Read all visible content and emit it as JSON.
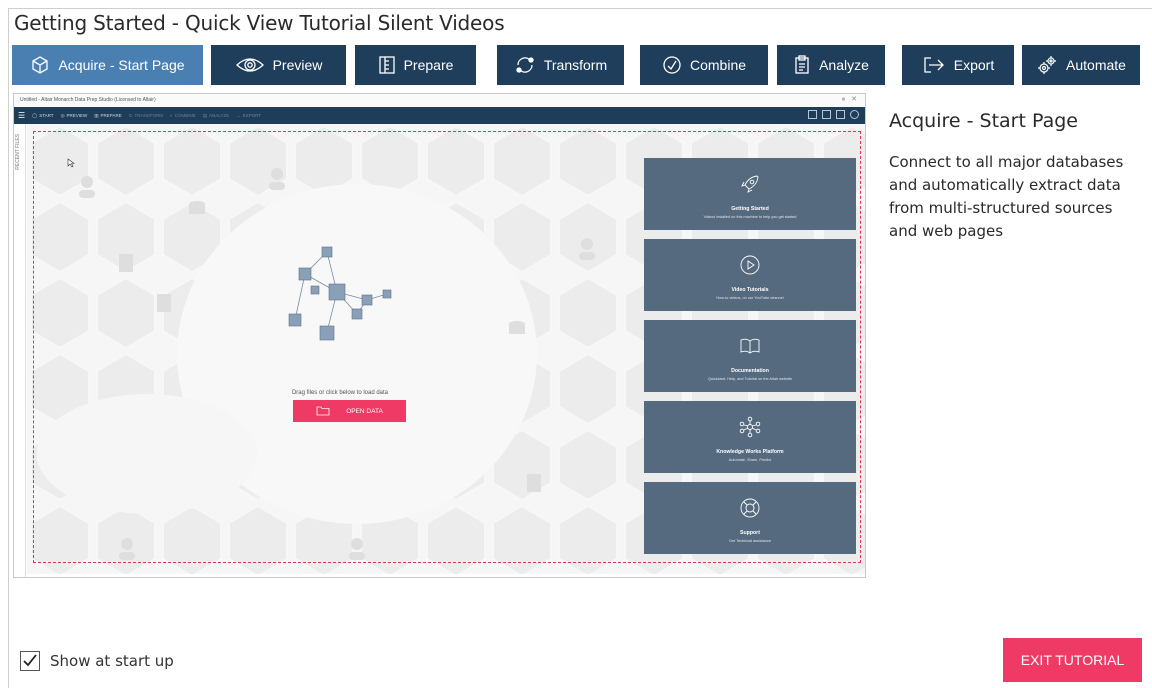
{
  "window": {
    "title": "Getting Started - Quick View Tutorial Silent Videos"
  },
  "tabs": [
    {
      "label": "Acquire - Start Page",
      "icon": "cube-icon",
      "active": true
    },
    {
      "label": "Preview",
      "icon": "eye-icon",
      "active": false
    },
    {
      "label": "Prepare",
      "icon": "columns-icon",
      "active": false
    },
    {
      "label": "Transform",
      "icon": "transform-cycle-icon",
      "active": false
    },
    {
      "label": "Combine",
      "icon": "combine-icon",
      "active": false
    },
    {
      "label": "Analyze",
      "icon": "clipboard-icon",
      "active": false
    },
    {
      "label": "Export",
      "icon": "export-arrow-icon",
      "active": false
    },
    {
      "label": "Automate",
      "icon": "gears-icon",
      "active": false
    }
  ],
  "screenshot": {
    "window_title": "Untitled - Altair Monarch Data Prep Studio (Licensed to Altair)",
    "toolbar_items": [
      {
        "label": "START",
        "dim": false
      },
      {
        "label": "PREVIEW",
        "dim": false
      },
      {
        "label": "PREPARE",
        "dim": false
      },
      {
        "label": "TRANSFORM",
        "dim": true
      },
      {
        "label": "COMBINE",
        "dim": true
      },
      {
        "label": "ANALYZE",
        "dim": true
      },
      {
        "label": "EXPORT",
        "dim": true
      }
    ],
    "recent_files_label": "RECENT FILES",
    "drop_text": "Drag files or click below to load data",
    "open_data_label": "OPEN DATA",
    "cards": [
      {
        "title": "Getting Started",
        "subtitle": "Videos installed on this machine to help you get started",
        "icon": "rocket-icon"
      },
      {
        "title": "Video Tutorials",
        "subtitle": "How-to videos, on our YouTube channel",
        "icon": "play-icon"
      },
      {
        "title": "Documentation",
        "subtitle": "Quickstart, Help, and Tutorial on the Altair website",
        "icon": "book-icon"
      },
      {
        "title": "Knowledge Works Platform",
        "subtitle": "Automate, Share, Predict",
        "icon": "network-icon"
      },
      {
        "title": "Support",
        "subtitle": "Get Technical assistance",
        "icon": "lifebuoy-icon"
      }
    ]
  },
  "side": {
    "title": "Acquire - Start Page",
    "description": "Connect to all major databases and automatically extract data from multi-structured sources and web pages"
  },
  "footer": {
    "show_at_startup_label": "Show at start up",
    "show_at_startup_checked": true,
    "exit_label": "EXIT TUTORIAL"
  },
  "colors": {
    "tab_bg": "#1e3e5b",
    "tab_active": "#4a7fb2",
    "accent": "#ee3a64",
    "card_bg": "#556a7f"
  }
}
